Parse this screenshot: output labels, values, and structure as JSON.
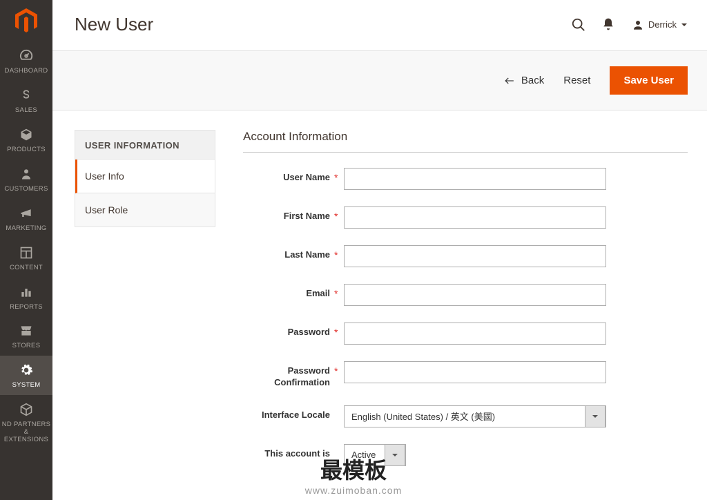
{
  "header": {
    "page_title": "New User",
    "user_name": "Derrick"
  },
  "sidebar_nav": {
    "items": [
      {
        "label": "DASHBOARD",
        "icon": "gauge"
      },
      {
        "label": "SALES",
        "icon": "dollar"
      },
      {
        "label": "PRODUCTS",
        "icon": "cube"
      },
      {
        "label": "CUSTOMERS",
        "icon": "person"
      },
      {
        "label": "MARKETING",
        "icon": "megaphone"
      },
      {
        "label": "CONTENT",
        "icon": "layout"
      },
      {
        "label": "REPORTS",
        "icon": "bars"
      },
      {
        "label": "STORES",
        "icon": "storefront"
      },
      {
        "label": "SYSTEM",
        "icon": "gear",
        "active": true
      },
      {
        "label": "ND PARTNERS & EXTENSIONS",
        "icon": "package"
      }
    ]
  },
  "actions": {
    "back": "Back",
    "reset": "Reset",
    "save": "Save User"
  },
  "side_tabs": {
    "title": "USER INFORMATION",
    "items": [
      {
        "label": "User Info",
        "active": true
      },
      {
        "label": "User Role"
      }
    ]
  },
  "form": {
    "section_title": "Account Information",
    "fields": {
      "user_name": {
        "label": "User Name",
        "required": true,
        "value": ""
      },
      "first_name": {
        "label": "First Name",
        "required": true,
        "value": ""
      },
      "last_name": {
        "label": "Last Name",
        "required": true,
        "value": ""
      },
      "email": {
        "label": "Email",
        "required": true,
        "value": ""
      },
      "password": {
        "label": "Password",
        "required": true,
        "value": ""
      },
      "password_confirm": {
        "label": "Password Confirmation",
        "required": true,
        "value": ""
      },
      "interface_locale": {
        "label": "Interface Locale",
        "required": false,
        "value": "English (United States) / 英文 (美國)"
      },
      "account_is": {
        "label": "This account is",
        "required": false,
        "value": "Active"
      }
    }
  },
  "watermark": {
    "big": "最模板",
    "small": "www.zuimoban.com"
  }
}
